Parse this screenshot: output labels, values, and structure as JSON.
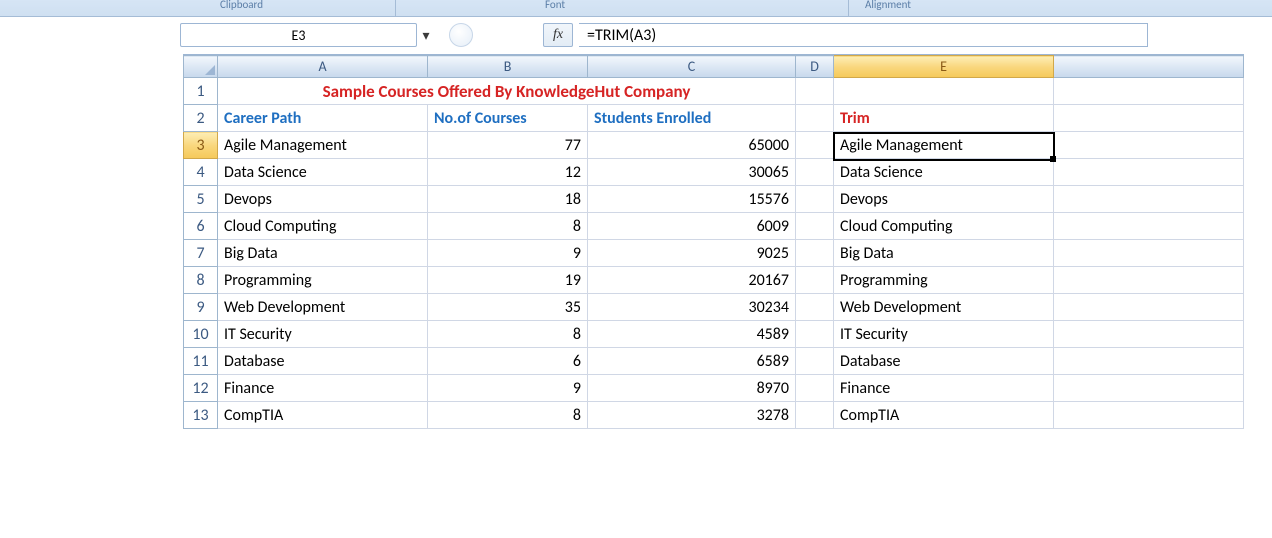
{
  "ribbon": {
    "group1": "Clipboard",
    "group2": "Font",
    "group3": "Alignment"
  },
  "namebox": {
    "value": "E3"
  },
  "fx": {
    "label": "fx"
  },
  "formula": {
    "value": "=TRIM(A3)"
  },
  "cols": {
    "A": "A",
    "B": "B",
    "C": "C",
    "D": "D",
    "E": "E",
    "F": ""
  },
  "rownums": [
    "1",
    "2",
    "3",
    "4",
    "5",
    "6",
    "7",
    "8",
    "9",
    "10",
    "11",
    "12",
    "13"
  ],
  "row1": {
    "title": "Sample Courses Offered By KnowledgeHut Company"
  },
  "row2": {
    "A": "Career Path",
    "B": "No.of Courses",
    "C": "Students Enrolled",
    "E": "Trim"
  },
  "data": [
    {
      "A": "Agile Management",
      "B": "77",
      "C": "65000",
      "E": "Agile Management"
    },
    {
      "A": "Data Science",
      "B": "12",
      "C": "30065",
      "E": "Data Science"
    },
    {
      "A": "Devops",
      "B": "18",
      "C": "15576",
      "E": "Devops"
    },
    {
      "A": "Cloud Computing",
      "B": "8",
      "C": "6009",
      "E": "Cloud Computing"
    },
    {
      "A": "Big Data",
      "B": "9",
      "C": "9025",
      "E": "Big Data"
    },
    {
      "A": "Programming",
      "B": "19",
      "C": "20167",
      "E": "Programming"
    },
    {
      "A": "Web Development",
      "B": "35",
      "C": "30234",
      "E": "Web Development"
    },
    {
      "A": "IT Security",
      "B": "8",
      "C": "4589",
      "E": "IT Security"
    },
    {
      "A": "Database",
      "B": "6",
      "C": "6589",
      "E": "Database"
    },
    {
      "A": "Finance",
      "B": "9",
      "C": "8970",
      "E": "Finance"
    },
    {
      "A": "CompTIA",
      "B": "8",
      "C": "3278",
      "E": "CompTIA"
    }
  ]
}
